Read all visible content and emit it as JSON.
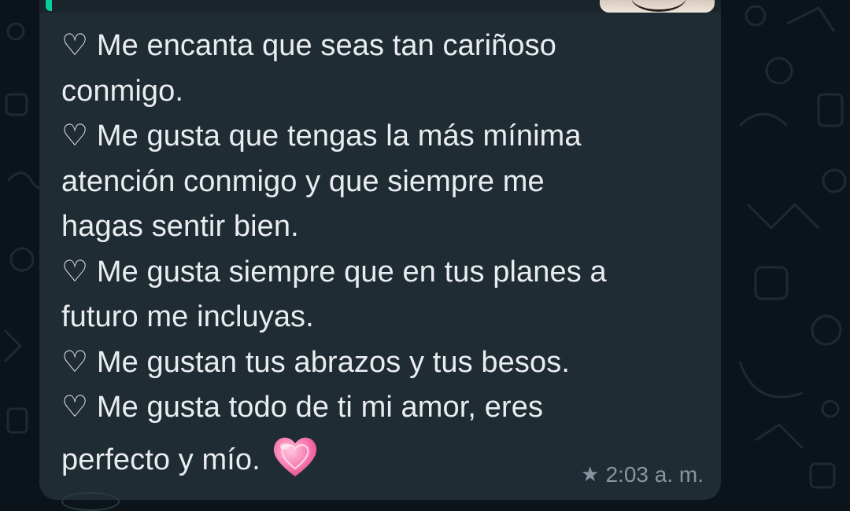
{
  "message": {
    "lines": [
      "♡ Me encanta que seas tan cariñoso",
      "conmigo.",
      "♡ Me gusta que tengas la más mínima",
      "atención conmigo y que siempre me",
      "hagas sentir bien.",
      "♡ Me gusta siempre que en tus planes a",
      "futuro me incluyas.",
      "♡ Me gustan tus abrazos y tus besos.",
      "♡ Me gusta todo de ti mi amor, eres",
      "perfecto y mío."
    ],
    "emoji": "growing-heart-emoji",
    "time": "2:03 a. m.",
    "starred_icon": "star-icon"
  },
  "colors": {
    "background": "#0b141a",
    "bubble": "#202c33",
    "text": "#e9edef",
    "meta": "#8696a0",
    "reply_accent": "#06cf9c",
    "emoji_pink": "#f25b9a"
  }
}
